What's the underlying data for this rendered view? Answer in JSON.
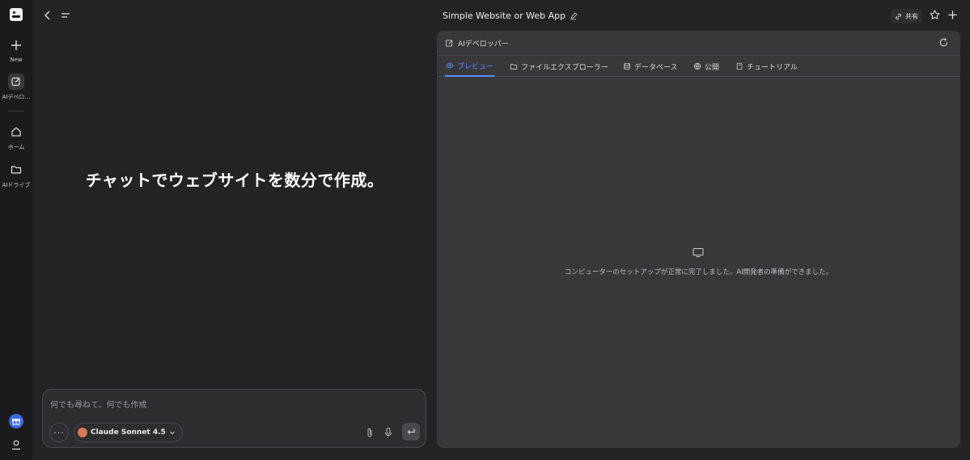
{
  "sidebar": {
    "new_label": "New",
    "dev_label": "AIデベロ…",
    "home_label": "ホーム",
    "drive_label": "AIドライブ"
  },
  "chat": {
    "headline": "チャットでウェブサイトを数分で作成。",
    "composer_placeholder": "何でも尋ねて、何でも作成",
    "model_name": "Claude Sonnet 4.5"
  },
  "header": {
    "title": "Simple Website or Web App",
    "share_label": "共有"
  },
  "panel": {
    "title": "AIデベロッパー",
    "tabs": [
      {
        "label": "プレビュー",
        "icon": "eye-icon",
        "active": true
      },
      {
        "label": "ファイルエクスプローラー",
        "icon": "folder-icon",
        "active": false
      },
      {
        "label": "データベース",
        "icon": "database-icon",
        "active": false
      },
      {
        "label": "公開",
        "icon": "globe-icon",
        "active": false
      },
      {
        "label": "チュートリアル",
        "icon": "book-icon",
        "active": false
      }
    ],
    "status_message": "コンピューターのセットアップが正常に完了しました。AI開発者の準備ができました。"
  },
  "colors": {
    "accent": "#5b8cff",
    "background": "#232325",
    "panel": "#38383b",
    "model_logo": "#d9775a",
    "gift": "#3d6be0"
  }
}
